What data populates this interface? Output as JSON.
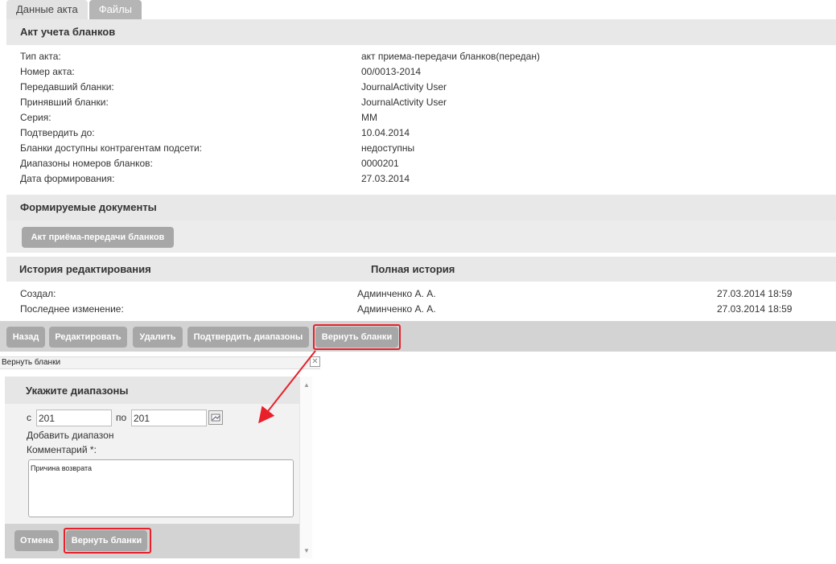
{
  "tabs": [
    {
      "label": "Данные акта",
      "active": true
    },
    {
      "label": "Файлы",
      "active": false
    }
  ],
  "act_section": {
    "title": "Акт учета бланков",
    "fields": [
      {
        "label": "Тип акта:",
        "value": "акт приема-передачи бланков(передан)"
      },
      {
        "label": "Номер акта:",
        "value": "00/0013-2014"
      },
      {
        "label": "Передавший бланки:",
        "value": "JournalActivity User"
      },
      {
        "label": "Принявший бланки:",
        "value": "JournalActivity User"
      },
      {
        "label": "Серия:",
        "value": "ММ"
      },
      {
        "label": "Подтвердить до:",
        "value": "10.04.2014"
      },
      {
        "label": "Бланки доступны контрагентам подсети:",
        "value": "недоступны"
      },
      {
        "label": "Диапазоны номеров бланков:",
        "value": "0000201"
      },
      {
        "label": "Дата формирования:",
        "value": "27.03.2014"
      }
    ]
  },
  "documents": {
    "title": "Формируемые документы",
    "button": "Акт приёма-передачи бланков"
  },
  "history": {
    "title": "История редактирования",
    "full_history_label": "Полная история",
    "rows": [
      {
        "label": "Создал:",
        "user": "Админченко А. А.",
        "date": "27.03.2014 18:59"
      },
      {
        "label": "Последнее изменение:",
        "user": "Админченко А. А.",
        "date": "27.03.2014 18:59"
      }
    ]
  },
  "toolbar": {
    "back": "Назад",
    "edit": "Редактировать",
    "delete": "Удалить",
    "confirm_ranges": "Подтвердить диапазоны",
    "return_blanks": "Вернуть бланки"
  },
  "dialog": {
    "title": "Вернуть бланки",
    "close_glyph": "✕",
    "header": "Укажите диапазоны",
    "from_label": "с",
    "from_value": "201",
    "to_label": "по",
    "to_value": "201",
    "add_range": "Добавить диапазон",
    "comment_label": "Комментарий *:",
    "comment_value": "Причина возврата",
    "cancel": "Отмена",
    "submit": "Вернуть бланки"
  },
  "colors": {
    "highlight": "#e8202a",
    "button_gray": "#a7a7a7",
    "band_gray": "#e8e8e8"
  }
}
